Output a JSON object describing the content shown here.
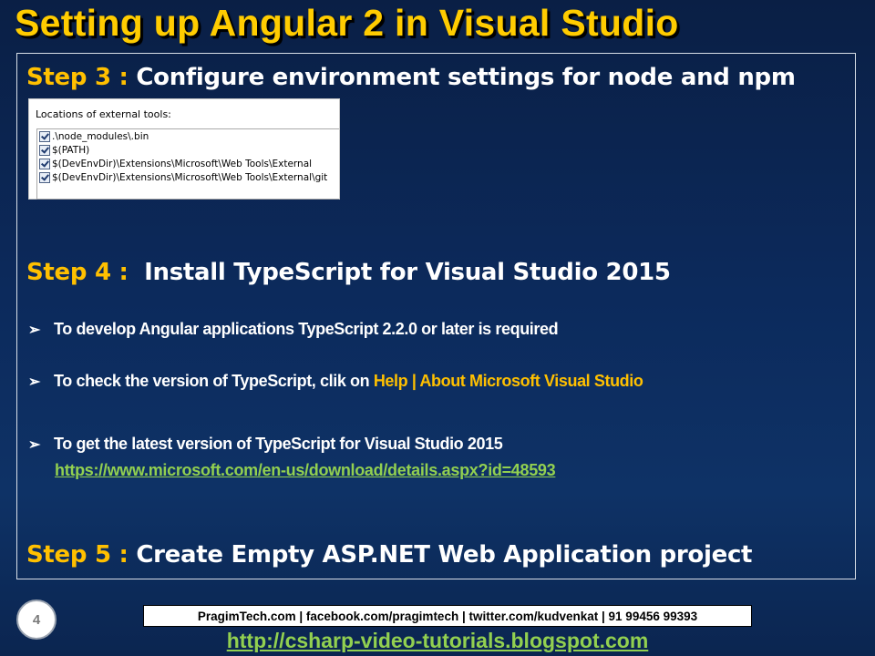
{
  "title": "Setting up Angular 2 in Visual Studio",
  "step3": {
    "label": "Step 3 :",
    "text": "Configure environment settings for node and npm"
  },
  "tools_panel": {
    "caption": "Locations of external tools:",
    "items": [
      ".\\node_modules\\.bin",
      "$(PATH)",
      "$(DevEnvDir)\\Extensions\\Microsoft\\Web Tools\\External",
      "$(DevEnvDir)\\Extensions\\Microsoft\\Web Tools\\External\\git"
    ]
  },
  "step4": {
    "label": "Step 4 :",
    "text": "Install TypeScript for Visual Studio 2015",
    "bullet_marker": "➢",
    "bullets": [
      "To develop Angular applications TypeScript 2.2.0 or later is required",
      "To check the version of TypeScript, clik on ",
      "To get the latest version of TypeScript for Visual Studio 2015"
    ],
    "bullet2_highlight": "Help | About Microsoft Visual Studio",
    "download_link": "https://www.microsoft.com/en-us/download/details.aspx?id=48593"
  },
  "step5": {
    "label": "Step 5 :",
    "text": "Create Empty ASP.NET Web Application project"
  },
  "page_number": "4",
  "footer": {
    "contact": "PragimTech.com | facebook.com/pragimtech  | twitter.com/kudvenkat  | 91 99456 99393",
    "blog_link": "http://csharp-video-tutorials.blogspot.com"
  },
  "colors": {
    "accent_yellow": "#ffc000",
    "link_green": "#92d050",
    "background": "#0c2a5c"
  }
}
